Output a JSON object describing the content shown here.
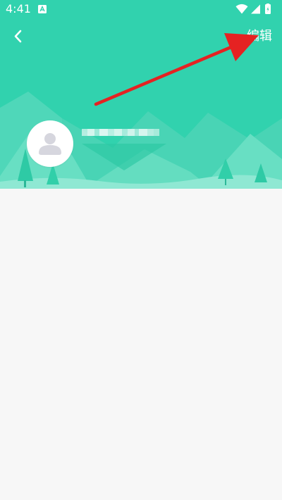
{
  "status_bar": {
    "time": "4:41",
    "notification_icon": "app-notification-icon",
    "icons": [
      "wifi-icon",
      "cellular-signal-icon",
      "battery-icon"
    ]
  },
  "toolbar": {
    "back_icon": "chevron-left-icon",
    "edit_label": "编辑"
  },
  "profile": {
    "avatar_icon": "user-avatar-icon",
    "username_obscured": true
  },
  "annotation": {
    "type": "arrow",
    "points_to": "edit-button",
    "color": "#e52222"
  },
  "colors": {
    "header": "#31d2ae",
    "scenery_light": "#6ee3c7",
    "scenery_mid": "#52dbbb",
    "tree": "#26c39c",
    "content_background": "#f7f7f7",
    "avatar_placeholder": "#d6d6de"
  }
}
